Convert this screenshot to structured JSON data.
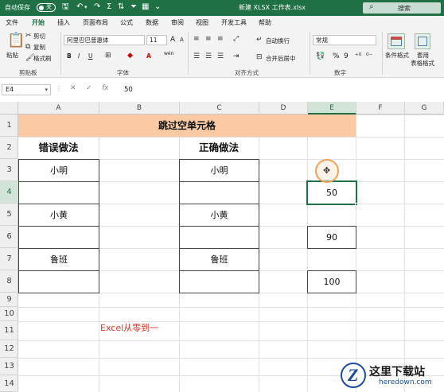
{
  "titlebar": {
    "autosave_label": "自动保存",
    "autosave_state": "关",
    "doc_title": "新建 XLSX 工作表.xlsx",
    "search_placeholder": "搜索"
  },
  "tabs": [
    "文件",
    "开始",
    "插入",
    "页面布局",
    "公式",
    "数据",
    "审阅",
    "视图",
    "开发工具",
    "帮助"
  ],
  "active_tab": "开始",
  "ribbon": {
    "clipboard": {
      "paste": "粘贴",
      "cut": "剪切",
      "copy": "复制",
      "format_painter": "格式刷",
      "label": "剪贴板"
    },
    "font": {
      "name": "阿里巴巴普惠体",
      "size": "11",
      "grow": "A",
      "shrink": "A",
      "label": "字体",
      "bold": "B",
      "italic": "I",
      "underline": "U",
      "wen": "wén"
    },
    "alignment": {
      "wrap": "自动换行",
      "merge": "合并后居中",
      "label": "对齐方式"
    },
    "number": {
      "format": "常规",
      "percent": "%",
      "comma": "9",
      "label": "数字"
    },
    "styles": {
      "conditional": "条件格式",
      "table_format_1": "套用",
      "table_format_2": "表格格式"
    }
  },
  "formula_bar": {
    "cell_ref": "E4",
    "formula": "50"
  },
  "columns": [
    "A",
    "B",
    "C",
    "D",
    "E",
    "F",
    "G"
  ],
  "rows": [
    "1",
    "2",
    "3",
    "4",
    "5",
    "6",
    "7",
    "8",
    "9",
    "10",
    "11",
    "12",
    "13",
    "14"
  ],
  "sheet": {
    "title": "跳过空单元格",
    "left_heading": "错误做法",
    "right_heading": "正确做法",
    "a3": "小明",
    "a5": "小黄",
    "a7": "鲁班",
    "c3": "小明",
    "c5": "小黄",
    "c7": "鲁班",
    "e4": "50",
    "e6": "90",
    "e8": "100",
    "b11": "Excel从零到一"
  },
  "watermark": {
    "logo": "Z",
    "name": "这里下载站",
    "url": "heredown.com"
  }
}
